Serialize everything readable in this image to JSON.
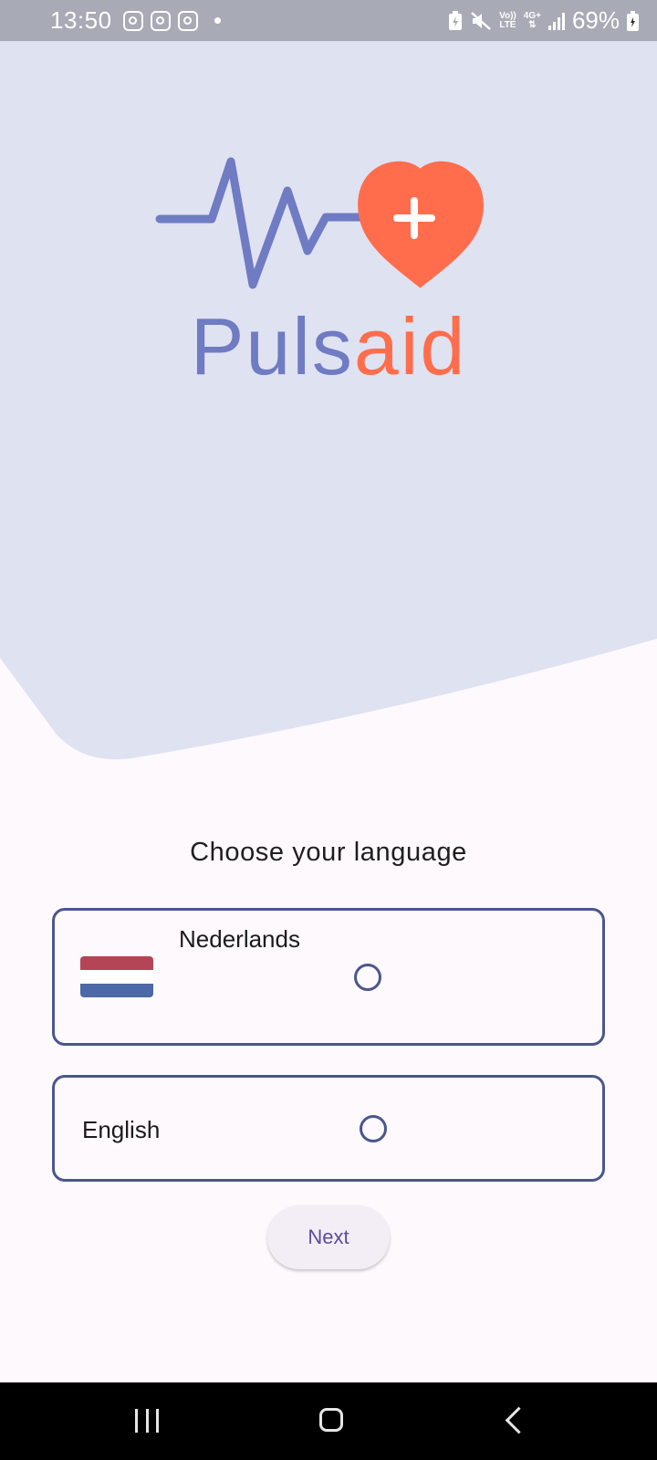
{
  "status_bar": {
    "time": "13:50",
    "network_top": "Vo))",
    "network_bottom": "LTE",
    "network_type": "4G+",
    "battery": "69%",
    "icons": [
      "instagram-icon",
      "instagram-icon",
      "instagram-icon",
      "notification-dot",
      "battery-saver-icon",
      "mute-icon",
      "volte-icon",
      "4g-icon",
      "signal-icon",
      "battery-icon"
    ]
  },
  "logo": {
    "text_part1": "Puls",
    "text_part2": "aid",
    "colors": {
      "primary": "#6f7bc2",
      "accent": "#ff6d4c"
    }
  },
  "language_screen": {
    "title": "Choose your language",
    "options": [
      {
        "label": "Nederlands",
        "flag_icon": "netherlands-flag-icon",
        "selected": false
      },
      {
        "label": "English",
        "selected": false
      }
    ],
    "next_label": "Next"
  },
  "colors": {
    "hero_background": "#dfe2f1",
    "page_background": "#fdf9fd",
    "border": "#4b5690",
    "button_text": "#5d4b9a"
  },
  "nav_bar": {
    "icons": [
      "recent-apps-icon",
      "home-icon",
      "back-icon"
    ]
  }
}
